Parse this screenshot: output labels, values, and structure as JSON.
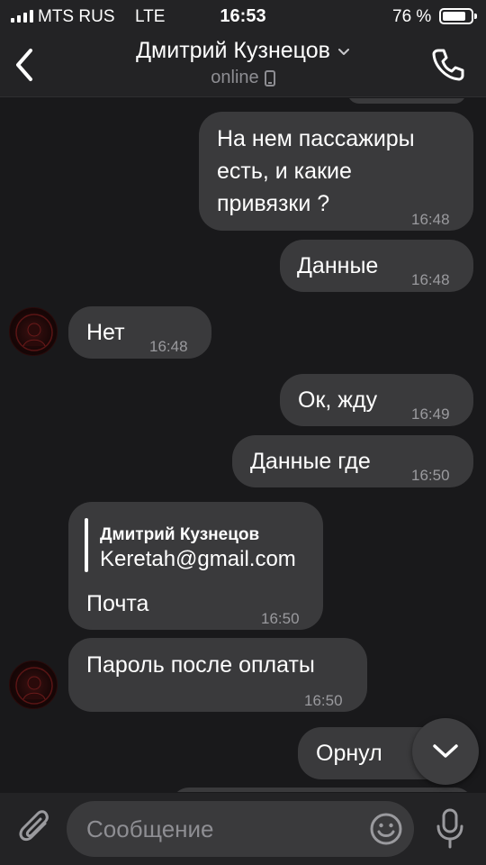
{
  "status_bar": {
    "carrier": "MTS RUS",
    "network": "LTE",
    "time": "16:53",
    "battery": "76 %"
  },
  "header": {
    "name": "Дмитрий Кузнецов",
    "status": "online"
  },
  "messages": [
    {
      "direction": "out",
      "text": "На нем пассажиры\nесть, и какие\nпривязки ?",
      "time": "16:48"
    },
    {
      "direction": "out",
      "text": "Данные",
      "time": "16:48"
    },
    {
      "direction": "in",
      "text": "Нет",
      "time": "16:48"
    },
    {
      "direction": "out",
      "text": "Ок, жду",
      "time": "16:49"
    },
    {
      "direction": "out",
      "text": "Данные где",
      "time": "16:50"
    },
    {
      "direction": "in",
      "reply_author": "Дмитрий Кузнецов",
      "reply_text": "Keretah@gmail.com",
      "text": "Почта",
      "time": "16:50"
    },
    {
      "direction": "in",
      "text": "Пароль после оплаты",
      "time": "16:50"
    },
    {
      "direction": "out",
      "text": "Орнул",
      "time": ""
    }
  ],
  "composer": {
    "placeholder": "Сообщение"
  },
  "icons": {
    "back": "chevron-left-icon",
    "call": "phone-icon",
    "attach": "paperclip-icon",
    "emoji": "smiley-icon",
    "mic": "microphone-icon",
    "scroll": "chevron-down-icon"
  },
  "colors": {
    "background": "#19191b",
    "bubble": "#3a3a3c",
    "header": "#232325",
    "muted": "#8e8e93"
  }
}
